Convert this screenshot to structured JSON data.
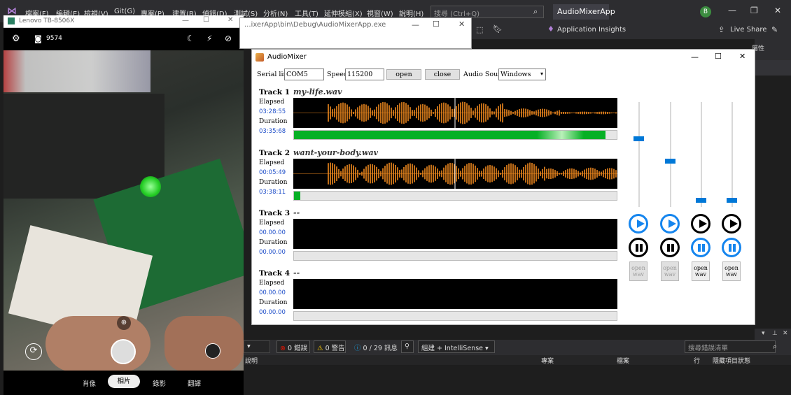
{
  "vs": {
    "menu": [
      "檔案(F)",
      "編輯(E)",
      "檢視(V)",
      "Git(G)",
      "專案(P)",
      "建置(B)",
      "偵錯(D)",
      "測試(S)",
      "分析(N)",
      "工具(T)",
      "延伸模組(X)",
      "視窗(W)",
      "說明(H)"
    ],
    "search_placeholder": "搜尋 (Ctrl+Q)",
    "app_title": "AudioMixerApp",
    "user_initial": "B",
    "app_insights": "Application Insights",
    "live_share": "Live Share",
    "properties_label": "屬性",
    "errors": "0 錯誤",
    "warnings": "0 警告",
    "messages": "0 / 29 訊息",
    "build_filter": "組建 + IntelliSense",
    "search_error_list": "搜尋錯誤清單",
    "col_description": "說明",
    "col_project": "專案",
    "col_file": "檔案",
    "col_line": "行",
    "col_suppression": "隱藏項目狀態"
  },
  "phone": {
    "window_title": "Lenovo TB-8506X",
    "counter": "9574",
    "modes": [
      "肖像",
      "相片",
      "錄影",
      "翻譯"
    ],
    "active_mode": "相片"
  },
  "bg_window": {
    "title": "...ixerApp\\bin\\Debug\\AudioMixerApp.exe"
  },
  "mixer": {
    "title": "AudioMixer",
    "serial_line_label": "Serial line:",
    "serial_line_value": "COM5",
    "speed_label": "Speed:",
    "speed_value": "115200",
    "open_label": "open",
    "close_label": "close",
    "audio_source_label": "Audio Source:",
    "audio_source_value": "Windows",
    "elapsed_label": "Elapsed",
    "duration_label": "Duration",
    "tracks": [
      {
        "name": "Track 1",
        "file": "my-life.wav",
        "elapsed": "03:28:55",
        "duration": "03:35:68",
        "progress": 0.965,
        "waveform": true
      },
      {
        "name": "Track 2",
        "file": "want-your-body.wav",
        "elapsed": "00:05:49",
        "duration": "03:38:11",
        "progress": 0.02,
        "waveform": true
      },
      {
        "name": "Track 3",
        "file": "--",
        "elapsed": "00.00.00",
        "duration": "00.00.00",
        "progress": 0,
        "waveform": false
      },
      {
        "name": "Track 4",
        "file": "--",
        "elapsed": "00.00.00",
        "duration": "00.00.00",
        "progress": 0,
        "waveform": false
      }
    ],
    "sliders": [
      0.65,
      0.42,
      0.02,
      0.02
    ],
    "open_wav_label": "open wav",
    "colors": {
      "accent": "#0078d7",
      "progress": "#06b025",
      "wave": "#f0891e",
      "time": "#1e4ec9",
      "blue_ctrl": "#1585ee"
    }
  }
}
